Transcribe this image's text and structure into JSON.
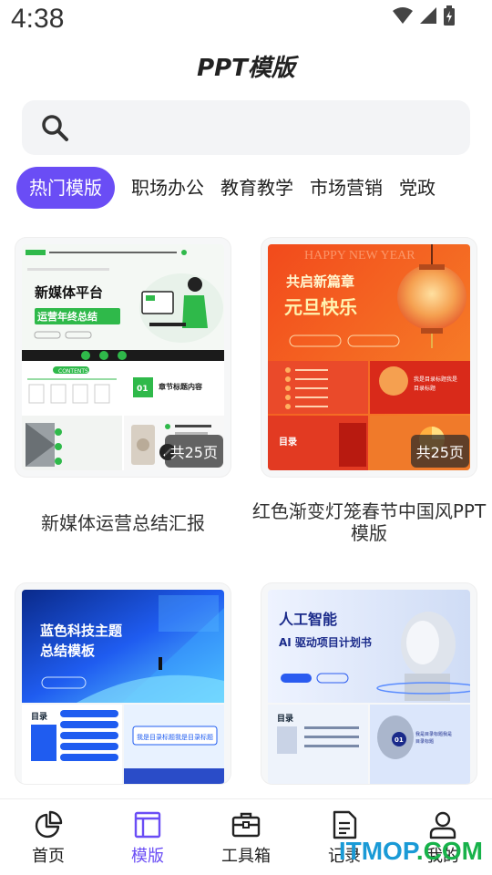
{
  "status_bar": {
    "time": "4:38"
  },
  "header": {
    "title": "PPT模版"
  },
  "search": {
    "placeholder": ""
  },
  "tabs": [
    {
      "label": "热门模版",
      "active": true
    },
    {
      "label": "职场办公",
      "active": false
    },
    {
      "label": "教育教学",
      "active": false
    },
    {
      "label": "市场营销",
      "active": false
    },
    {
      "label": "党政",
      "active": false
    }
  ],
  "templates": [
    {
      "title": "新媒体运营总结汇报",
      "count": "共25页",
      "thumb_heading": "新媒体平台",
      "thumb_sub": "运营年终总结",
      "thumb_section": "章节标题内容",
      "thumb_contents": "CONTENTS",
      "accent": "#2fb94a"
    },
    {
      "title": "红色渐变灯笼春节中国风PPT模版",
      "count": "共25页",
      "thumb_heading": "共启新篇章",
      "thumb_sub": "元旦快乐",
      "thumb_bg": "HAPPY NEW YEAR",
      "thumb_toc": "目录",
      "thumb_toc2": "我是目录标题我是\n目录标题",
      "accent": "#e63b1f"
    },
    {
      "title": "",
      "thumb_heading": "蓝色科技主题",
      "thumb_sub": "总结模板",
      "thumb_toc": "目录",
      "thumb_toc2": "我是目录标题我是目录标题",
      "accent": "#1f6bf0"
    },
    {
      "title": "",
      "thumb_heading": "人工智能",
      "thumb_sub": "AI 驱动项目计划书",
      "thumb_toc": "目录",
      "thumb_toc2": "我是目录标题我是目录标题",
      "accent": "#2a5bf0"
    }
  ],
  "bottom_nav": [
    {
      "label": "首页",
      "icon": "pie-chart-icon",
      "active": false
    },
    {
      "label": "模版",
      "icon": "template-icon",
      "active": true
    },
    {
      "label": "工具箱",
      "icon": "toolbox-icon",
      "active": false
    },
    {
      "label": "记录",
      "icon": "document-icon",
      "active": false
    },
    {
      "label": "我的",
      "icon": "user-icon",
      "active": false
    }
  ],
  "watermark": {
    "part1": "ITMOP",
    "part2": ".COM"
  },
  "colors": {
    "accent": "#6a4df5",
    "search_bg": "#f3f4f6"
  }
}
